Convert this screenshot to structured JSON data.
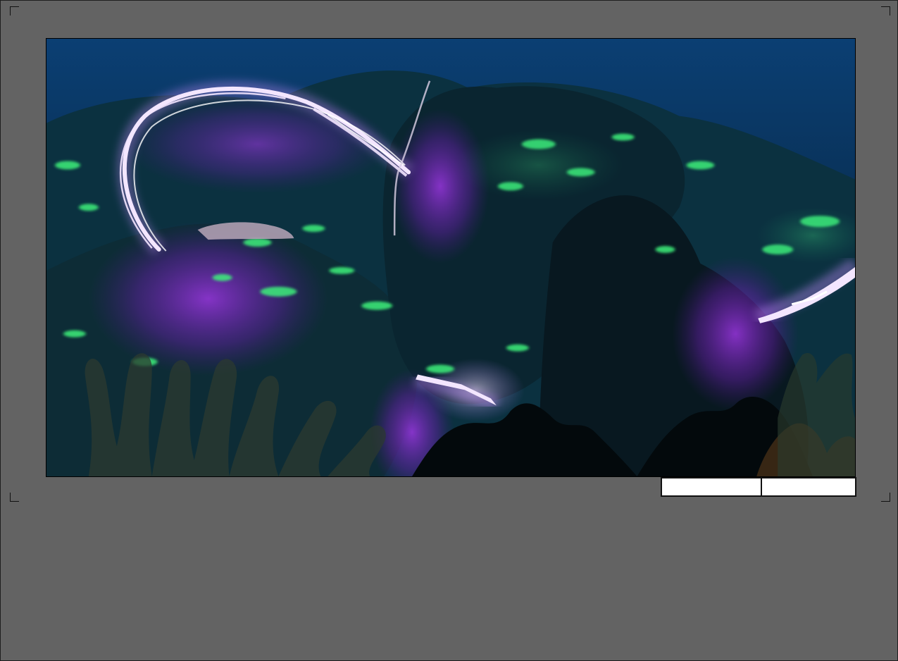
{
  "canvas": {
    "scene": "underwater-reef-with-glowing-tentacles",
    "colors": {
      "water_top": "#0a3a6b",
      "water_bottom": "#04192c",
      "rock": "#0b2a33",
      "algae_glow": "#3cf07a",
      "purple_glow": "#8a2bd1",
      "tentacle": "#f3e6ff"
    }
  },
  "fields": {
    "left": {
      "value": ""
    },
    "right": {
      "value": ""
    }
  }
}
